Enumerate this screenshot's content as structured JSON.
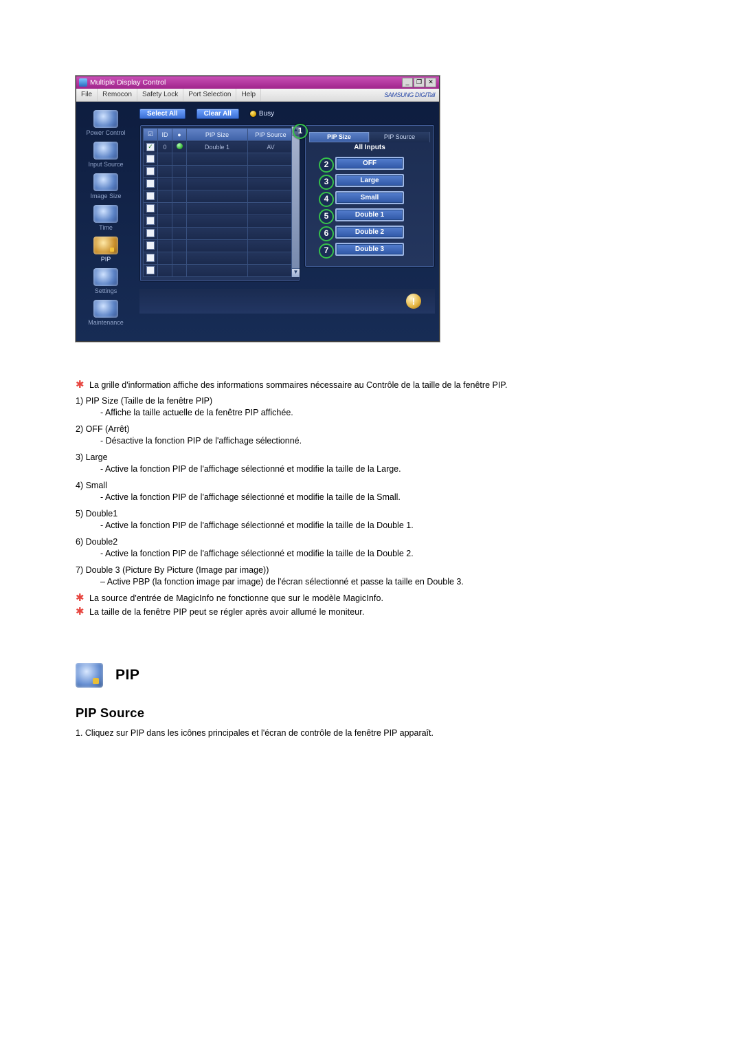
{
  "app": {
    "title": "Multiple Display Control",
    "menubar": {
      "items": [
        "File",
        "Remocon",
        "Safety Lock",
        "Port Selection",
        "Help"
      ],
      "brand": "SAMSUNG DIGITall"
    },
    "winbtns": {
      "min": "_",
      "max": "❐",
      "close": "✕"
    },
    "sidebar": [
      {
        "label": "Power Control",
        "active": false
      },
      {
        "label": "Input Source",
        "active": false
      },
      {
        "label": "Image Size",
        "active": false
      },
      {
        "label": "Time",
        "active": false
      },
      {
        "label": "PIP",
        "active": true
      },
      {
        "label": "Settings",
        "active": false
      },
      {
        "label": "Maintenance",
        "active": false
      }
    ],
    "toolbar": {
      "selectAll": "Select All",
      "clearAll": "Clear All",
      "busy": "Busy"
    },
    "tabs": {
      "left": "PIP Size",
      "right": "PIP Source"
    },
    "grid": {
      "headers": {
        "chk": "☑",
        "id": "ID",
        "status": "●",
        "size": "PIP Size",
        "source": "PIP Source"
      },
      "row": {
        "chkOn": true,
        "id": "0",
        "statusOn": true,
        "size": "Double 1",
        "source": "AV"
      },
      "emptyRows": 10
    },
    "rightPanel": {
      "allInputs": "All Inputs",
      "buttons": [
        {
          "n": "2",
          "t": "OFF"
        },
        {
          "n": "3",
          "t": "Large"
        },
        {
          "n": "4",
          "t": "Small"
        },
        {
          "n": "5",
          "t": "Double 1"
        },
        {
          "n": "6",
          "t": "Double 2"
        },
        {
          "n": "7",
          "t": "Double 3"
        }
      ]
    },
    "callout1": "1"
  },
  "doc": {
    "star1": "La grille d'information affiche des informations sommaires nécessaire au Contrôle de la taille de la fenêtre PIP.",
    "items": [
      {
        "h": "1)  PIP Size (Taille de la fenêtre PIP)",
        "s": "- Affiche la taille actuelle de la fenêtre PIP affichée."
      },
      {
        "h": "2)  OFF (Arrêt)",
        "s": "- Désactive la fonction PIP de l'affichage sélectionné."
      },
      {
        "h": "3)  Large",
        "s": "- Active la fonction PIP de l'affichage sélectionné et modifie la taille de la Large."
      },
      {
        "h": "4)  Small",
        "s": "- Active la fonction PIP de l'affichage sélectionné et modifie la taille de la Small."
      },
      {
        "h": "5)  Double1",
        "s": "- Active la fonction PIP de l'affichage sélectionné et modifie la taille de la Double 1."
      },
      {
        "h": "6)  Double2",
        "s": "- Active la fonction PIP de l'affichage sélectionné et modifie la taille de la Double 2."
      },
      {
        "h": "7)  Double 3 (Picture By Picture (Image par image))",
        "s": "– Active PBP (la fonction image par image) de l'écran sélectionné et passe la taille en Double 3."
      }
    ],
    "star2": "La source d'entrée de MagicInfo ne fonctionne que sur le modèle MagicInfo.",
    "star3": "La taille de la fenêtre PIP peut se régler après avoir allumé le moniteur.",
    "sectionTitle": "PIP",
    "subTitle": "PIP Source",
    "olitem": "1.  Cliquez sur PIP dans les icônes principales et l'écran de contrôle de la fenêtre PIP apparaît."
  }
}
